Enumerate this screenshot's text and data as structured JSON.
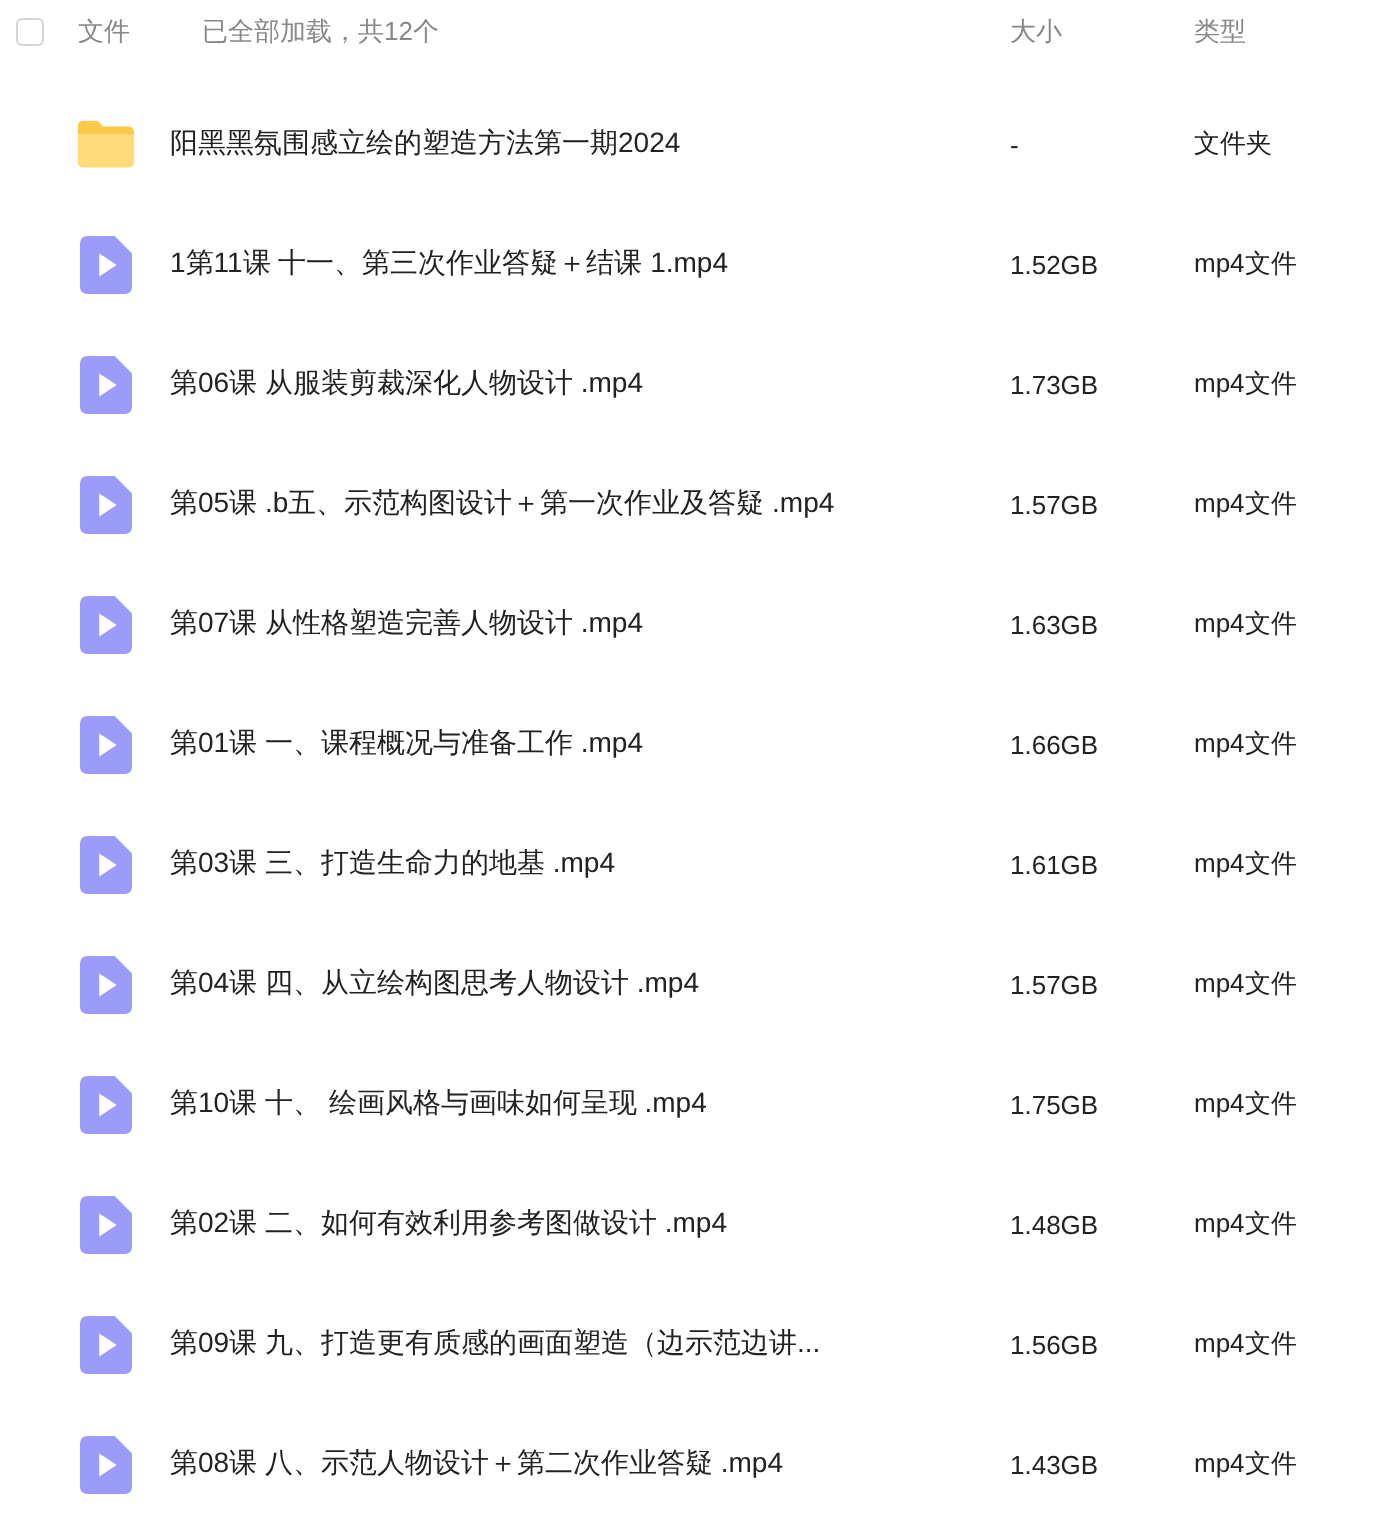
{
  "header": {
    "checked": false,
    "name_label": "文件",
    "status": "已全部加载，共12个",
    "size_label": "大小",
    "type_label": "类型"
  },
  "files": [
    {
      "kind": "folder",
      "name": "阳黑黑氛围感立绘的塑造方法第一期2024",
      "size": "-",
      "type": "文件夹"
    },
    {
      "kind": "video",
      "name": "1第11课 十一、第三次作业答疑＋结课 1.mp4",
      "size": "1.52GB",
      "type": "mp4文件"
    },
    {
      "kind": "video",
      "name": "第06课 从服装剪裁深化人物设计 .mp4",
      "size": "1.73GB",
      "type": "mp4文件"
    },
    {
      "kind": "video",
      "name": "第05课 .b五、示范构图设计＋第一次作业及答疑 .mp4",
      "size": "1.57GB",
      "type": "mp4文件"
    },
    {
      "kind": "video",
      "name": "第07课 从性格塑造完善人物设计 .mp4",
      "size": "1.63GB",
      "type": "mp4文件"
    },
    {
      "kind": "video",
      "name": "第01课 一、课程概况与准备工作 .mp4",
      "size": "1.66GB",
      "type": "mp4文件"
    },
    {
      "kind": "video",
      "name": "第03课 三、打造生命力的地基 .mp4",
      "size": "1.61GB",
      "type": "mp4文件"
    },
    {
      "kind": "video",
      "name": "第04课 四、从立绘构图思考人物设计 .mp4",
      "size": "1.57GB",
      "type": "mp4文件"
    },
    {
      "kind": "video",
      "name": "第10课 十、 绘画风格与画味如何呈现 .mp4",
      "size": "1.75GB",
      "type": "mp4文件"
    },
    {
      "kind": "video",
      "name": "第02课 二、如何有效利用参考图做设计 .mp4",
      "size": "1.48GB",
      "type": "mp4文件"
    },
    {
      "kind": "video",
      "name": "第09课 九、打造更有质感的画面塑造（边示范边讲...",
      "size": "1.56GB",
      "type": "mp4文件"
    },
    {
      "kind": "video",
      "name": "第08课 八、示范人物设计＋第二次作业答疑 .mp4",
      "size": "1.43GB",
      "type": "mp4文件"
    }
  ]
}
